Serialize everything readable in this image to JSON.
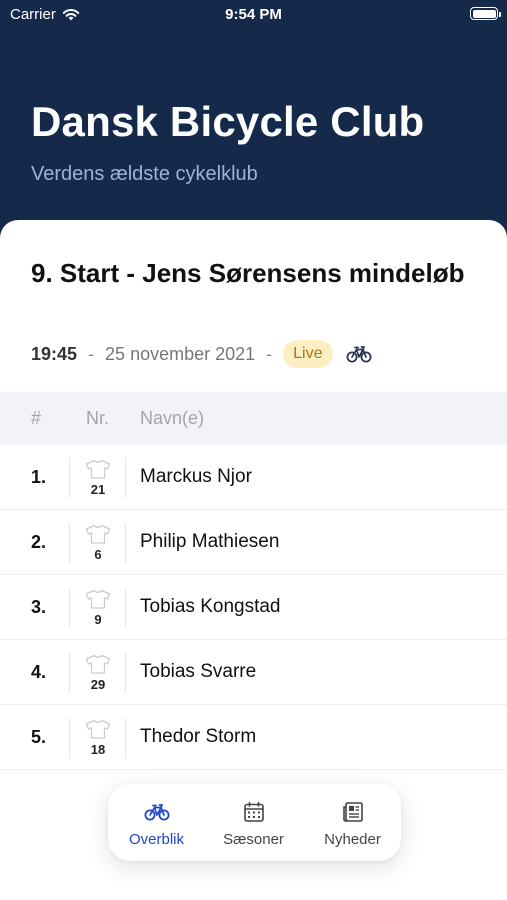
{
  "status_bar": {
    "carrier": "Carrier",
    "time": "9:54 PM"
  },
  "header": {
    "title": "Dansk Bicycle Club",
    "subtitle": "Verdens ældste cykelklub"
  },
  "race": {
    "title": "9. Start - Jens Sørensens mindeløb",
    "time": "19:45",
    "separator": "-",
    "date": "25 november 2021",
    "status": "Live",
    "type_icon": "bicycle-icon"
  },
  "table": {
    "headers": {
      "position": "#",
      "number": "Nr.",
      "name": "Navn(e)"
    },
    "rows": [
      {
        "position": "1.",
        "number": "21",
        "name": "Marckus Njor"
      },
      {
        "position": "2.",
        "number": "6",
        "name": "Philip Mathiesen"
      },
      {
        "position": "3.",
        "number": "9",
        "name": "Tobias Kongstad"
      },
      {
        "position": "4.",
        "number": "29",
        "name": "Tobias Svarre"
      },
      {
        "position": "5.",
        "number": "18",
        "name": "Thedor Storm"
      }
    ]
  },
  "tabs": [
    {
      "label": "Overblik",
      "icon": "bicycle-icon",
      "active": true
    },
    {
      "label": "Sæsoner",
      "icon": "calendar-icon",
      "active": false
    },
    {
      "label": "Nyheder",
      "icon": "newspaper-icon",
      "active": false
    }
  ],
  "colors": {
    "header_bg": "#152a4a",
    "accent": "#1f46c8",
    "live_bg": "#fcefc2",
    "live_text": "#b0711a"
  }
}
